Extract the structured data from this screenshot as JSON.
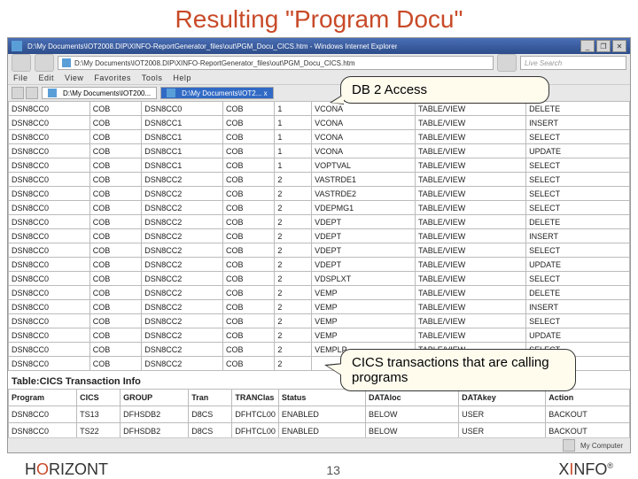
{
  "slide": {
    "title": "Resulting \"Program Docu\"",
    "page": "13"
  },
  "browser": {
    "title": "D:\\My Documents\\IOT2008.DIP\\XINFO-ReportGenerator_files\\out\\PGM_Docu_CICS.htm - Windows Internet Explorer",
    "url": "D:\\My Documents\\IOT2008.DIP\\XINFO-ReportGenerator_files\\out\\PGM_Docu_CICS.htm",
    "search_placeholder": "Live Search",
    "menu": [
      "File",
      "Edit",
      "View",
      "Favorites",
      "Tools",
      "Help"
    ],
    "tabs": [
      {
        "label": "D:\\My Documents\\IOT200..."
      },
      {
        "label": "D:\\My Documents\\IOT2... x"
      }
    ],
    "status": "My Computer"
  },
  "callouts": {
    "db2": "DB 2 Access",
    "cics": "CICS transactions that are calling programs"
  },
  "table1": [
    [
      "DSN8CC0",
      "COB",
      "DSN8CC0",
      "COB",
      "1",
      "VCONA",
      "TABLE/VIEW",
      "DELETE"
    ],
    [
      "DSN8CC0",
      "COB",
      "DSN8CC1",
      "COB",
      "1",
      "VCONA",
      "TABLE/VIEW",
      "INSERT"
    ],
    [
      "DSN8CC0",
      "COB",
      "DSN8CC1",
      "COB",
      "1",
      "VCONA",
      "TABLE/VIEW",
      "SELECT"
    ],
    [
      "DSN8CC0",
      "COB",
      "DSN8CC1",
      "COB",
      "1",
      "VCONA",
      "TABLE/VIEW",
      "UPDATE"
    ],
    [
      "DSN8CC0",
      "COB",
      "DSN8CC1",
      "COB",
      "1",
      "VOPTVAL",
      "TABLE/VIEW",
      "SELECT"
    ],
    [
      "DSN8CC0",
      "COB",
      "DSN8CC2",
      "COB",
      "2",
      "VASTRDE1",
      "TABLE/VIEW",
      "SELECT"
    ],
    [
      "DSN8CC0",
      "COB",
      "DSN8CC2",
      "COB",
      "2",
      "VASTRDE2",
      "TABLE/VIEW",
      "SELECT"
    ],
    [
      "DSN8CC0",
      "COB",
      "DSN8CC2",
      "COB",
      "2",
      "VDEPMG1",
      "TABLE/VIEW",
      "SELECT"
    ],
    [
      "DSN8CC0",
      "COB",
      "DSN8CC2",
      "COB",
      "2",
      "VDEPT",
      "TABLE/VIEW",
      "DELETE"
    ],
    [
      "DSN8CC0",
      "COB",
      "DSN8CC2",
      "COB",
      "2",
      "VDEPT",
      "TABLE/VIEW",
      "INSERT"
    ],
    [
      "DSN8CC0",
      "COB",
      "DSN8CC2",
      "COB",
      "2",
      "VDEPT",
      "TABLE/VIEW",
      "SELECT"
    ],
    [
      "DSN8CC0",
      "COB",
      "DSN8CC2",
      "COB",
      "2",
      "VDEPT",
      "TABLE/VIEW",
      "UPDATE"
    ],
    [
      "DSN8CC0",
      "COB",
      "DSN8CC2",
      "COB",
      "2",
      "VDSPLXT",
      "TABLE/VIEW",
      "SELECT"
    ],
    [
      "DSN8CC0",
      "COB",
      "DSN8CC2",
      "COB",
      "2",
      "VEMP",
      "TABLE/VIEW",
      "DELETE"
    ],
    [
      "DSN8CC0",
      "COB",
      "DSN8CC2",
      "COB",
      "2",
      "VEMP",
      "TABLE/VIEW",
      "INSERT"
    ],
    [
      "DSN8CC0",
      "COB",
      "DSN8CC2",
      "COB",
      "2",
      "VEMP",
      "TABLE/VIEW",
      "SELECT"
    ],
    [
      "DSN8CC0",
      "COB",
      "DSN8CC2",
      "COB",
      "2",
      "VEMP",
      "TABLE/VIEW",
      "UPDATE"
    ],
    [
      "DSN8CC0",
      "COB",
      "DSN8CC2",
      "COB",
      "2",
      "VEMPLP",
      "TABLE/VIEW",
      "SELECT"
    ],
    [
      "DSN8CC0",
      "COB",
      "DSN8CC2",
      "COB",
      "2",
      "",
      "",
      ""
    ]
  ],
  "subheader": "Table:CICS Transaction Info",
  "table2": {
    "head": [
      "Program",
      "CICS",
      "GROUP",
      "Tran",
      "TRANClas",
      "Status",
      "DATAloc",
      "DATAkey",
      "Action"
    ],
    "rows": [
      [
        "DSN8CC0",
        "TS13",
        "DFHSDB2",
        "D8CS",
        "DFHTCL00",
        "ENABLED",
        "BELOW",
        "USER",
        "BACKOUT"
      ],
      [
        "DSN8CC0",
        "TS22",
        "DFHSDB2",
        "D8CS",
        "DFHTCL00",
        "ENABLED",
        "BELOW",
        "USER",
        "BACKOUT"
      ]
    ]
  },
  "footerL": [
    "H",
    "O",
    "RIZONT"
  ],
  "footerR": [
    "X",
    "I",
    "NFO"
  ]
}
